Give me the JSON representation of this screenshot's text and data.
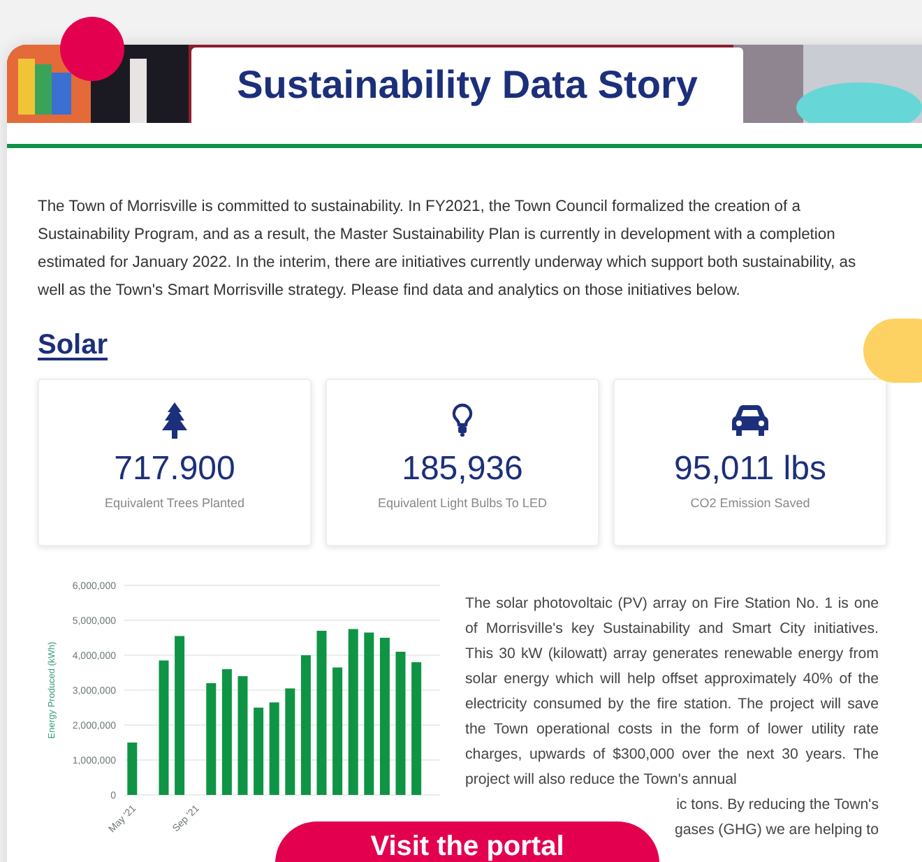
{
  "header": {
    "title": "Sustainability Data Story"
  },
  "intro": "The Town of Morrisville is committed to sustainability. In FY2021, the Town Council formalized the creation of a Sustainability Program, and as a result, the Master Sustainability Plan is currently in development with a completion estimated for January 2022. In the interim, there are initiatives currently underway which support both sustainability, as well as the Town's Smart Morrisville strategy. Please find data and analytics on those initiatives below.",
  "section": {
    "title": "Solar"
  },
  "stats": [
    {
      "kind": "tree",
      "value": "717.900",
      "label": "Equivalent Trees Planted"
    },
    {
      "kind": "bulb",
      "value": "185,936",
      "label": "Equivalent Light Bulbs To LED"
    },
    {
      "kind": "car",
      "value": "95,011 lbs",
      "label": "CO2 Emission Saved"
    }
  ],
  "chart": {
    "chart_data": {
      "type": "bar",
      "ylabel": "Energy Produced (kWh)",
      "categories": [
        "May '21",
        null,
        null,
        null,
        "Sep '21",
        null,
        null,
        null,
        null,
        null,
        null,
        null,
        null,
        null,
        null,
        null,
        null,
        null,
        null,
        null
      ],
      "series": [
        {
          "color": "#0f9445",
          "values": [
            1500000,
            null,
            3850000,
            4550000,
            null,
            3200000,
            3600000,
            3400000,
            2500000,
            2650000,
            3050000,
            4000000,
            4700000,
            3650000,
            4750000,
            4650000,
            4500000,
            4100000,
            3800000,
            null
          ]
        }
      ],
      "ylim": [
        0,
        6000000
      ],
      "grid": true,
      "yticks": [
        {
          "value": 0,
          "label": "0"
        },
        {
          "value": 1000000,
          "label": "1,000,000"
        },
        {
          "value": 2000000,
          "label": "2,000,000"
        },
        {
          "value": 3000000,
          "label": "3,000,000"
        },
        {
          "value": 4000000,
          "label": "4,000,000"
        },
        {
          "value": 5000000,
          "label": "5,000,000"
        },
        {
          "value": 6000000,
          "label": "6,000,000"
        }
      ]
    }
  },
  "description": "The solar photovoltaic (PV) array on Fire Station No. 1 is one of Morrisville's key Sustainability and Smart City initiatives. This 30 kW (kilowatt) array generates renewable energy from solar energy which will help offset approximately 40% of the electricity consumed by the fire station. The project will save the Town operational costs in the form of lower utility rate charges, upwards of $300,000 over the next 30 years. The project will also reduce the Town's annual",
  "description_fragments": [
    "ic tons. By reducing the Town's",
    "gases (GHG) we are helping to"
  ],
  "cta": {
    "label": "Visit the portal"
  }
}
